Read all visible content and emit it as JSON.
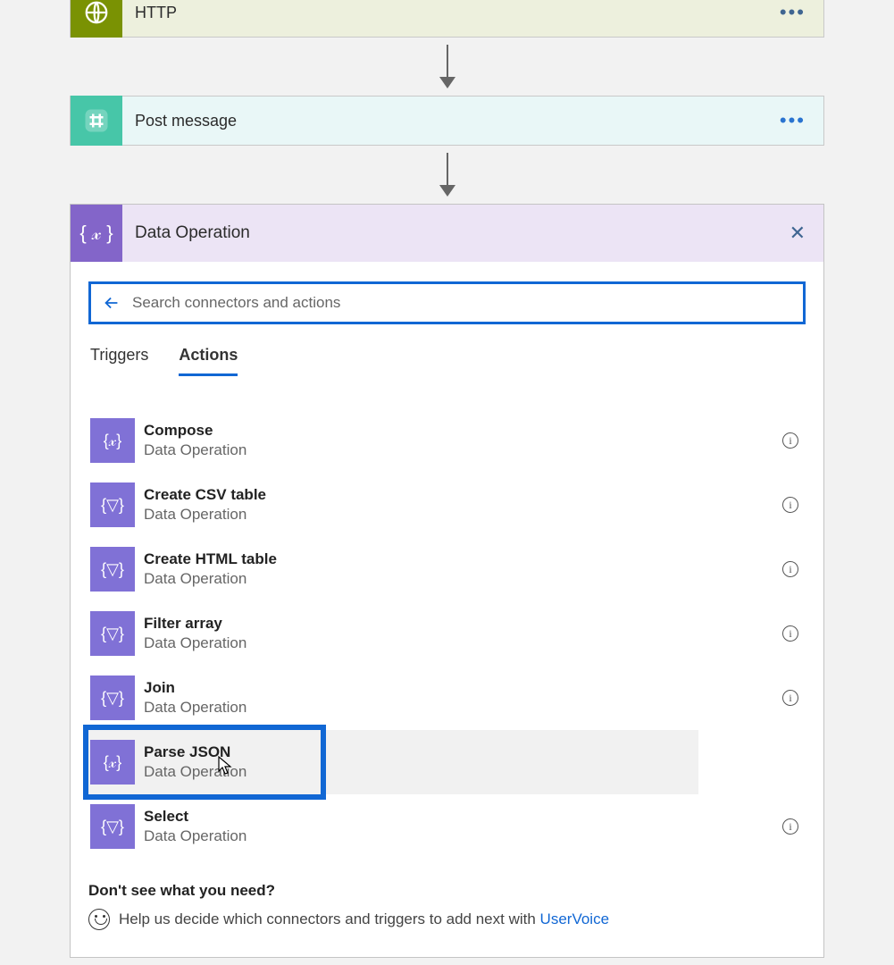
{
  "steps": {
    "http": "HTTP",
    "post": "Post message"
  },
  "panel": {
    "title": "Data Operation",
    "search_placeholder": "Search connectors and actions"
  },
  "tabs": {
    "triggers": "Triggers",
    "actions": "Actions"
  },
  "action_subtitle": "Data Operation",
  "actions": {
    "compose": "Compose",
    "create_csv": "Create CSV table",
    "create_html": "Create HTML table",
    "filter_array": "Filter array",
    "join": "Join",
    "parse_json": "Parse JSON",
    "select": "Select"
  },
  "footer": {
    "question": "Don't see what you need?",
    "help_text": "Help us decide which connectors and triggers to add next with ",
    "link": "UserVoice"
  }
}
